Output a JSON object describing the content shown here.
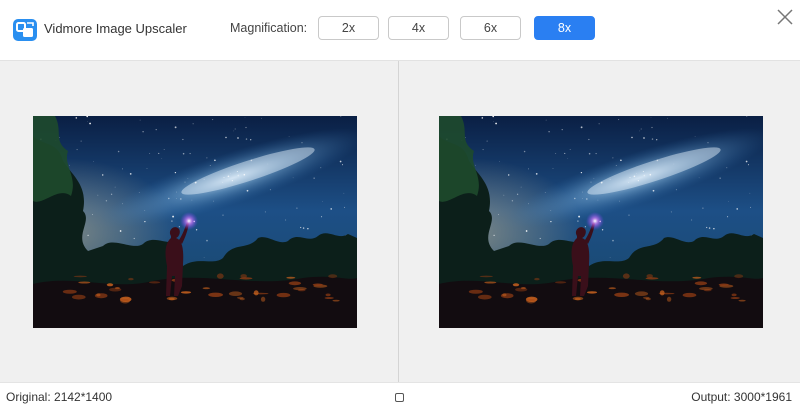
{
  "app": {
    "title": "Vidmore Image Upscaler",
    "icon": "upscaler-app-icon"
  },
  "magnification": {
    "label": "Magnification:",
    "options": [
      "2x",
      "4x",
      "6x",
      "8x"
    ],
    "selected": "8x"
  },
  "window": {
    "close_icon": "close-icon"
  },
  "preview": {
    "original_image": "starry-night-milky-way-person-with-flashlight",
    "output_image": "starry-night-milky-way-person-with-flashlight-upscaled"
  },
  "status": {
    "original": "Original: 2142*1400",
    "output": "Output: 3000*1961",
    "split_toggle_icon": "split-view-toggle-icon"
  },
  "colors": {
    "accent": "#2a7ff2",
    "panel_background": "#f0f0f0"
  }
}
